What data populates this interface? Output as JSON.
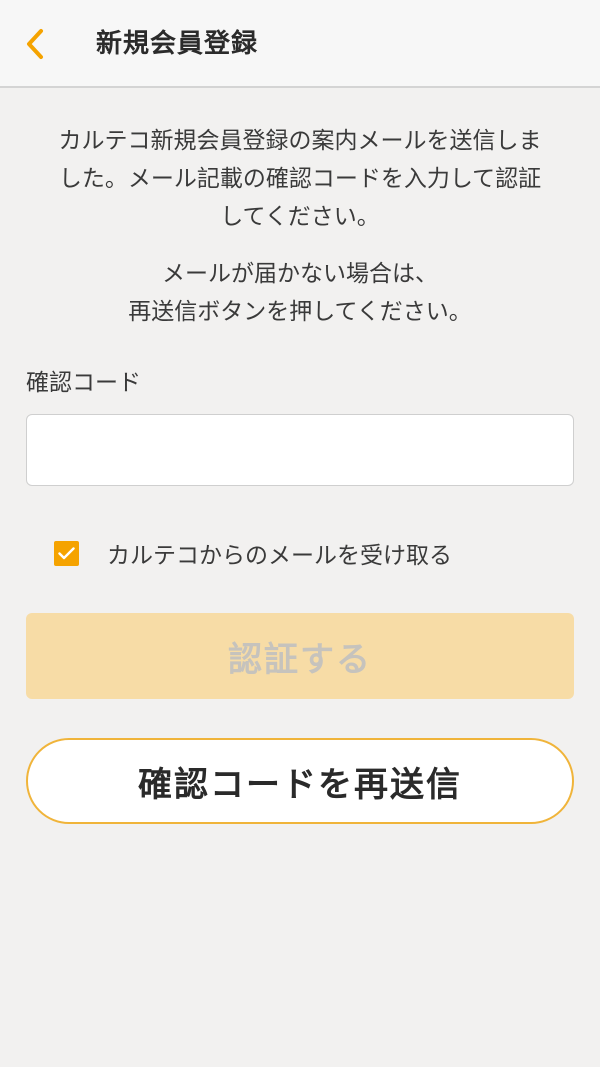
{
  "nav": {
    "title": "新規会員登録",
    "back_icon": "chevron-left-icon"
  },
  "intro": {
    "line1": "カルテコ新規会員登録の案内メールを送信しま",
    "line2": "した。メール記載の確認コードを入力して認証",
    "line3": "してください。",
    "notice_line1": "メールが届かない場合は、",
    "notice_line2": "再送信ボタンを押してください。"
  },
  "form": {
    "code_label": "確認コード",
    "code_value": "",
    "code_placeholder": "",
    "newsletter_label": "カルテコからのメールを受け取る",
    "newsletter_checked": true
  },
  "buttons": {
    "verify_label": "認証する",
    "verify_enabled": false,
    "resend_label": "確認コードを再送信"
  },
  "colors": {
    "accent": "#f5a300",
    "verify_disabled_bg": "#f7dca6",
    "verify_disabled_text": "#c6c3bd",
    "resend_border": "#f0b43a",
    "background": "#f2f1f0",
    "nav_background": "#f7f7f7"
  }
}
